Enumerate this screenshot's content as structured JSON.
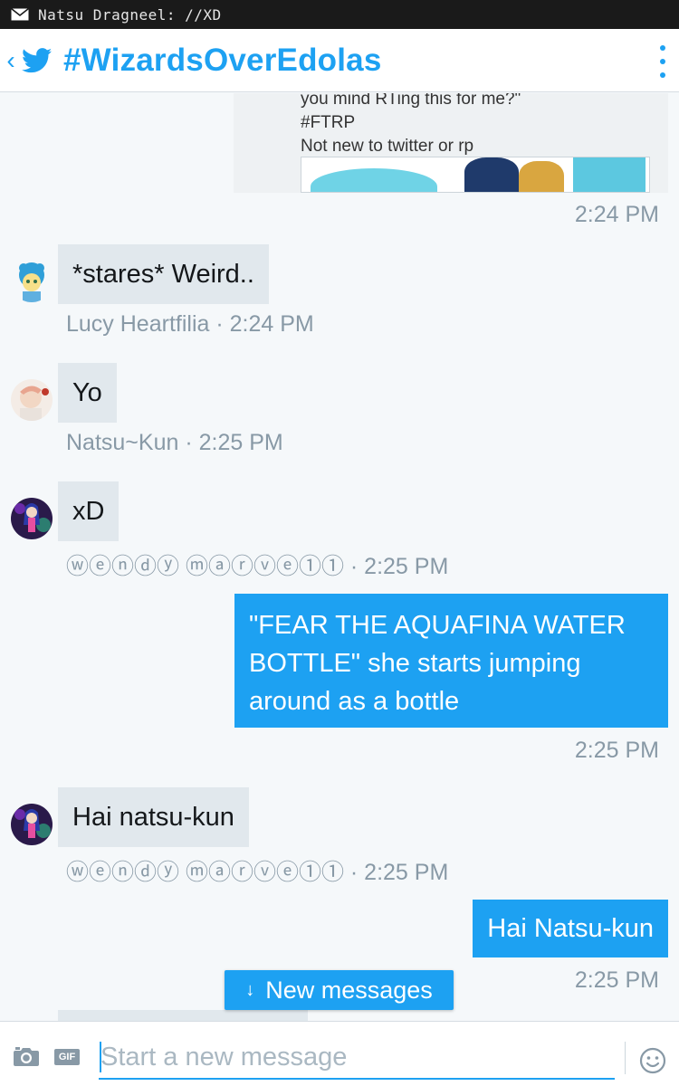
{
  "status_bar": {
    "notification": "Natsu Dragneel: //XD"
  },
  "header": {
    "back_glyph": "‹",
    "title": "#WizardsOverEdolas",
    "menu_icon": "kebab-menu-icon"
  },
  "quoted_card": {
    "lines": [
      "you mind RTing this for me?\"",
      "#FTRP",
      "Not new to twitter or rp"
    ]
  },
  "messages": [
    {
      "direction": "outgoing",
      "time": "2:24 PM"
    },
    {
      "direction": "incoming",
      "text": "*stares* Weird..",
      "meta": "Lucy Heartfilia · 2:24 PM"
    },
    {
      "direction": "incoming",
      "text": "Yo",
      "meta": "Natsu~Kun · 2:25 PM"
    },
    {
      "direction": "incoming",
      "text": "xD",
      "meta": "ⓦⓔⓝⓓⓨ ⓜⓐⓡⓥⓔ①① · 2:25 PM"
    },
    {
      "direction": "outgoing",
      "text": "\"FEAR THE AQUAFINA WATER BOTTLE\" she starts jumping around as a bottle",
      "time": "2:25 PM"
    },
    {
      "direction": "incoming",
      "text": "Hai natsu-kun",
      "meta": "ⓦⓔⓝⓓⓨ ⓜⓐⓡⓥⓔ①① · 2:25 PM"
    },
    {
      "direction": "outgoing",
      "text": "Hai Natsu-kun",
      "time": "2:25 PM"
    }
  ],
  "new_messages_pill": {
    "arrow": "↓",
    "label": "New messages"
  },
  "compose": {
    "placeholder": "Start a new message",
    "gif_label": "GIF"
  },
  "colors": {
    "accent": "#1da1f2",
    "incoming_bubble": "#e1e8ed",
    "meta_text": "#8899a6"
  }
}
